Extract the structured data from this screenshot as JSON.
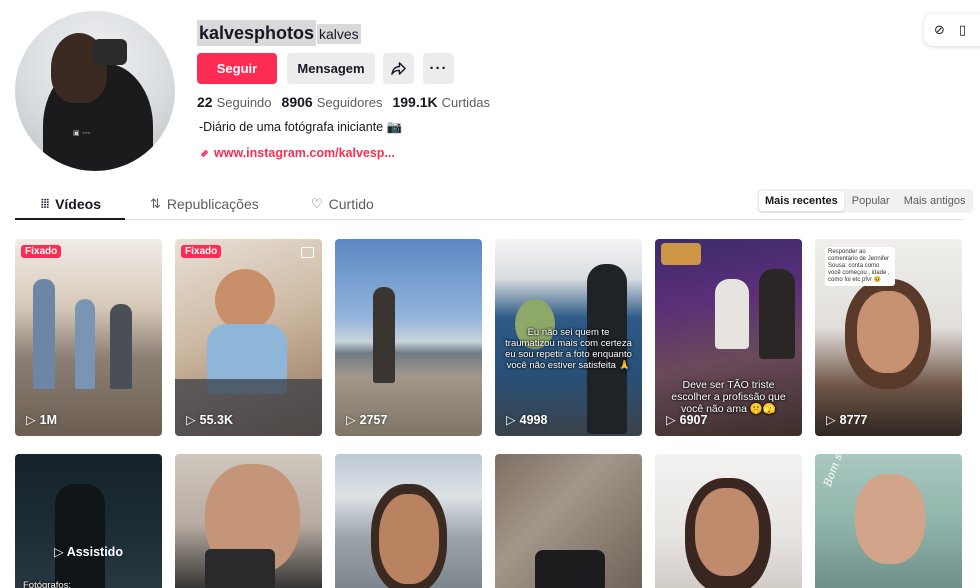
{
  "profile": {
    "username": "kalvesphotos",
    "nickname": "kalves",
    "follow_label": "Seguir",
    "message_label": "Mensagem",
    "more_label": "···",
    "stats": [
      {
        "num": "22",
        "label": "Seguindo"
      },
      {
        "num": "8906",
        "label": "Seguidores"
      },
      {
        "num": "199.1K",
        "label": "Curtidas"
      }
    ],
    "bio": "-Diário de uma fotógrafa iniciante 📷",
    "link": "www.instagram.com/kalvesp..."
  },
  "tabs": [
    {
      "label": "Vídeos",
      "icon": "grid-icon"
    },
    {
      "label": "Republicações",
      "icon": "repost-icon"
    },
    {
      "label": "Curtido",
      "icon": "heart-icon"
    }
  ],
  "sort": {
    "options": [
      "Mais recentes",
      "Popular",
      "Mais antigos"
    ],
    "selected": "Mais recentes"
  },
  "videos_row1": [
    {
      "badge": "Fixado",
      "views": "1M"
    },
    {
      "badge": "Fixado",
      "views": "55.3K"
    },
    {
      "badge": "",
      "views": "2757"
    },
    {
      "badge": "",
      "views": "4998",
      "caption": "Eu não sei quem te traumatizou mais com certeza eu sou repetir a foto enquanto você não estiver satisfeita 🙏"
    },
    {
      "badge": "",
      "views": "6907",
      "caption": "Deve ser TÃO triste escolher a profissão que você não ama 🤫🫣"
    },
    {
      "badge": "",
      "views": "8777",
      "bubble": "Responder ao comentário de Jennifer Sousa: conta como você começou , idade , como foi etc pfvr 🥹"
    }
  ],
  "videos_row2": [
    {
      "watched": "Assistido",
      "caption": "Fotógrafos: "
    },
    {},
    {},
    {},
    {},
    {
      "script": "Bom senso Luna"
    }
  ],
  "accent": "#fe2c55"
}
